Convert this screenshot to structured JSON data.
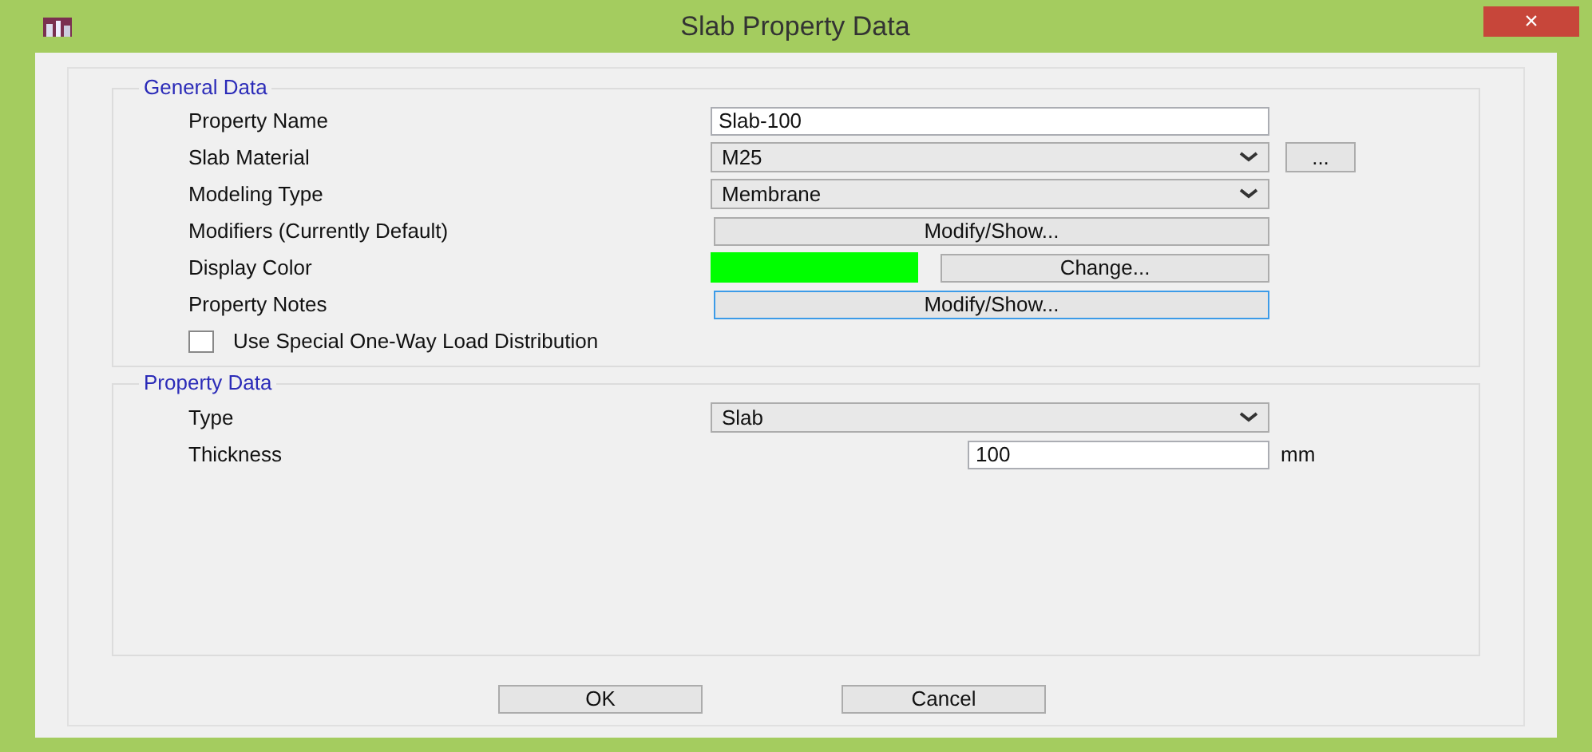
{
  "window": {
    "title": "Slab Property Data",
    "close": "×"
  },
  "general": {
    "title": "General Data",
    "rows": [
      {
        "label": "Property Name",
        "kind": "text",
        "value": "Slab-100"
      },
      {
        "label": "Slab Material",
        "kind": "dropdown",
        "value": "M25",
        "extra_button": "..."
      },
      {
        "label": "Modeling Type",
        "kind": "dropdown",
        "value": "Membrane"
      },
      {
        "label": "Modifiers (Currently Default)",
        "kind": "button",
        "value": "Modify/Show...",
        "focused": false
      },
      {
        "label": "Display Color",
        "kind": "color",
        "color": "#00ff00",
        "button": "Change..."
      },
      {
        "label": "Property Notes",
        "kind": "button",
        "value": "Modify/Show...",
        "focused": true
      }
    ],
    "checkbox": {
      "label": "Use Special One-Way Load Distribution",
      "checked": false
    }
  },
  "property": {
    "title": "Property Data",
    "rows": [
      {
        "label": "Type",
        "kind": "dropdown",
        "value": "Slab"
      },
      {
        "label": "Thickness",
        "kind": "number",
        "value": "100",
        "unit": "mm"
      }
    ]
  },
  "buttons": [
    "OK",
    "Cancel"
  ]
}
